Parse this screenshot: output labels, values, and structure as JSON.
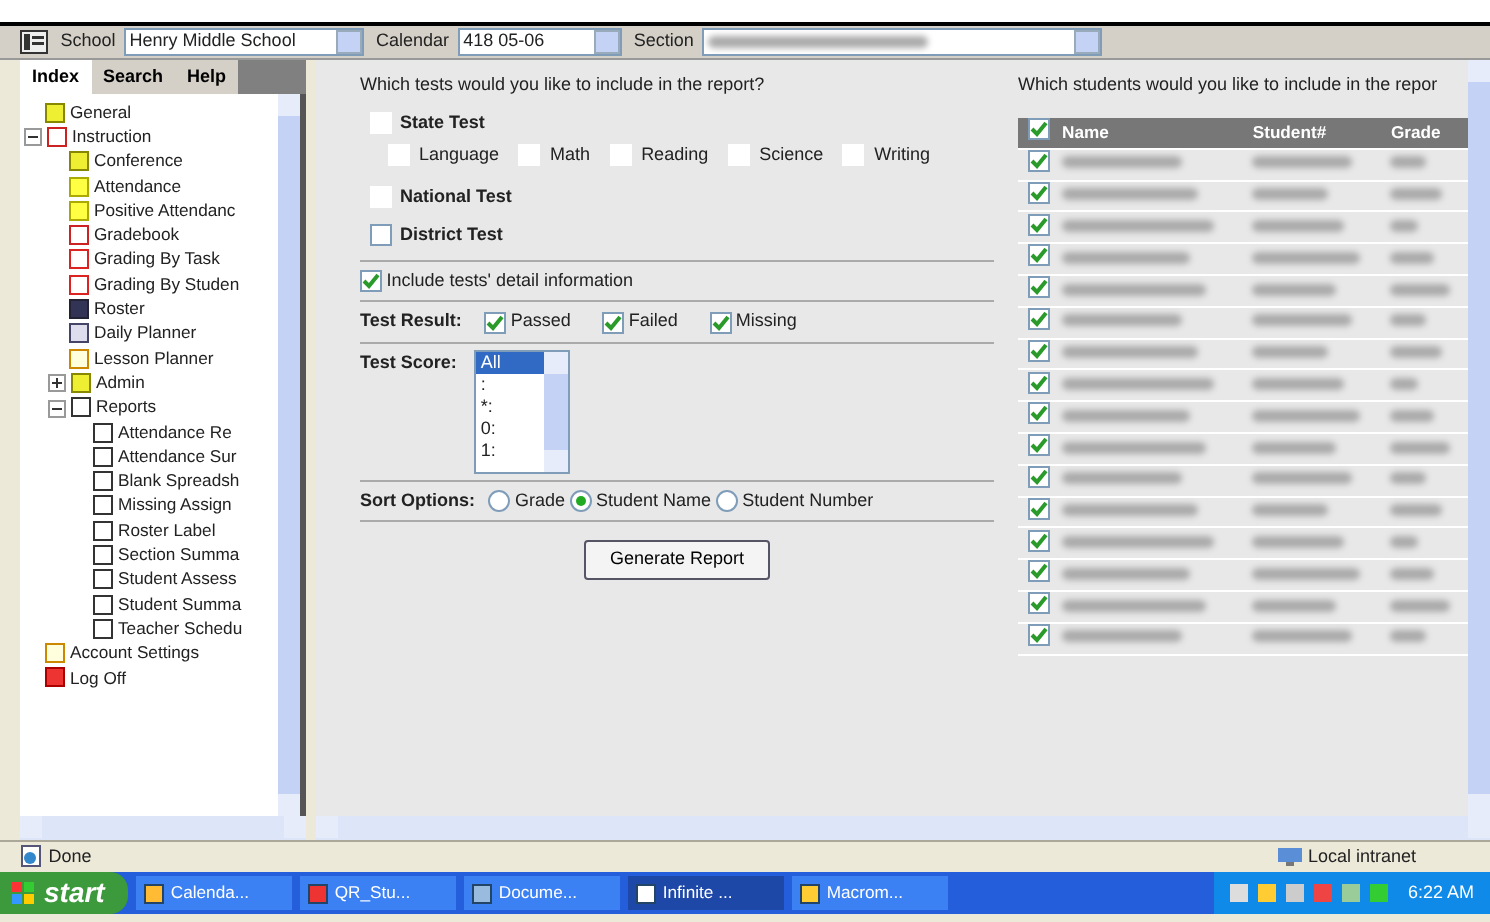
{
  "toolbar": {
    "fields": [
      {
        "label": "School",
        "value": "Henry Middle School"
      },
      {
        "label": "Calendar",
        "value": "418 05-06"
      },
      {
        "label": "Section",
        "blurred": true
      }
    ]
  },
  "sidebar": {
    "tabs": [
      {
        "label": "Index",
        "selected": true
      },
      {
        "label": "Search",
        "selected": false
      },
      {
        "label": "Help",
        "selected": false
      }
    ],
    "tree": [
      {
        "label": "General",
        "kind": "folder"
      },
      {
        "label": "Instruction",
        "kind": "book",
        "expanded": true,
        "children": [
          {
            "label": "Conference",
            "kind": "folder"
          },
          {
            "label": "Attendance",
            "kind": "lamp"
          },
          {
            "label": "Positive Attendanc",
            "kind": "lamp"
          },
          {
            "label": "Gradebook",
            "kind": "book"
          },
          {
            "label": "Grading By Task",
            "kind": "grade"
          },
          {
            "label": "Grading By Studen",
            "kind": "grade"
          },
          {
            "label": "Roster",
            "kind": "grid"
          },
          {
            "label": "Daily Planner",
            "kind": "planner"
          },
          {
            "label": "Lesson Planner",
            "kind": "pad"
          },
          {
            "label": "Admin",
            "kind": "folder",
            "expanded": false
          },
          {
            "label": "Reports",
            "kind": "doc",
            "expanded": true,
            "children": [
              {
                "label": "Attendance Re",
                "kind": "doc"
              },
              {
                "label": "Attendance Sur",
                "kind": "doc"
              },
              {
                "label": "Blank Spreadsh",
                "kind": "doc"
              },
              {
                "label": "Missing Assign",
                "kind": "doc"
              },
              {
                "label": "Roster Label",
                "kind": "doc"
              },
              {
                "label": "Section Summa",
                "kind": "doc"
              },
              {
                "label": "Student Assess",
                "kind": "doc"
              },
              {
                "label": "Student Summa",
                "kind": "doc"
              },
              {
                "label": "Teacher Schedu",
                "kind": "doc"
              }
            ]
          }
        ]
      },
      {
        "label": "Account Settings",
        "kind": "pad"
      },
      {
        "label": "Log Off",
        "kind": "power"
      }
    ]
  },
  "tests": {
    "question": "Which tests would you like to include in the report?",
    "groups": [
      {
        "label": "State Test",
        "checked": false,
        "kind": "plain",
        "subtests": [
          {
            "label": "Language",
            "checked": false
          },
          {
            "label": "Math",
            "checked": false
          },
          {
            "label": "Reading",
            "checked": false
          },
          {
            "label": "Science",
            "checked": false
          },
          {
            "label": "Writing",
            "checked": false
          }
        ]
      },
      {
        "label": "National Test",
        "checked": false,
        "kind": "plain"
      },
      {
        "label": "District Test",
        "checked": false,
        "kind": "framed"
      }
    ],
    "detail": {
      "label": "Include tests' detail information",
      "checked": true
    },
    "result": {
      "label": "Test Result:",
      "options": [
        {
          "label": "Passed",
          "checked": true
        },
        {
          "label": "Failed",
          "checked": true
        },
        {
          "label": "Missing",
          "checked": true
        }
      ]
    },
    "score": {
      "label": "Test Score:",
      "options": [
        {
          "label": "All",
          "selected": true
        },
        {
          "label": ":",
          "selected": false
        },
        {
          "label": "*:",
          "selected": false
        },
        {
          "label": "0:",
          "selected": false
        },
        {
          "label": "1:",
          "selected": false
        }
      ]
    },
    "sort": {
      "label": "Sort Options:",
      "options": [
        {
          "label": "Grade",
          "selected": false
        },
        {
          "label": "Student Name",
          "selected": true
        },
        {
          "label": "Student Number",
          "selected": false
        }
      ]
    },
    "button": "Generate Report"
  },
  "students": {
    "question": "Which students would you like to include in the repor",
    "all_checked": true,
    "columns": [
      "Name",
      "Student#",
      "Grade"
    ],
    "rows": [
      {
        "checked": true
      },
      {
        "checked": true
      },
      {
        "checked": true
      },
      {
        "checked": true
      },
      {
        "checked": true
      },
      {
        "checked": true
      },
      {
        "checked": true
      },
      {
        "checked": true
      },
      {
        "checked": true
      },
      {
        "checked": true
      },
      {
        "checked": true
      },
      {
        "checked": true
      },
      {
        "checked": true
      },
      {
        "checked": true
      },
      {
        "checked": true
      },
      {
        "checked": true
      }
    ]
  },
  "status_bar": {
    "text": "Done",
    "zone": "Local intranet"
  },
  "taskbar": {
    "start": "start",
    "items": [
      {
        "label": "Calenda...",
        "selected": false
      },
      {
        "label": "QR_Stu...",
        "selected": false
      },
      {
        "label": "Docume...",
        "selected": false
      },
      {
        "label": "Infinite ...",
        "selected": true
      },
      {
        "label": "Macrom...",
        "selected": false
      }
    ],
    "clock": "6:22 AM"
  }
}
